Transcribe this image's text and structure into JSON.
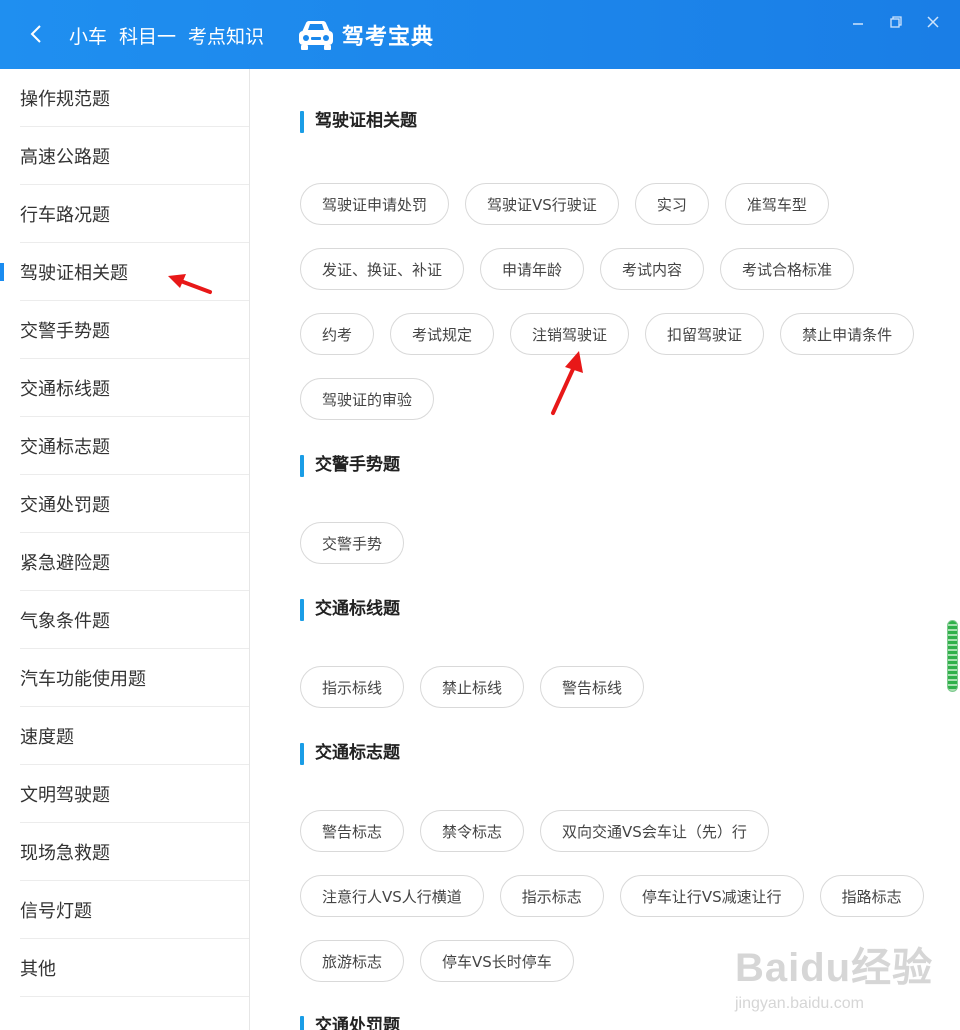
{
  "titlebar": {
    "breadcrumb": [
      "小车",
      "科目一",
      "考点知识"
    ],
    "brand": "驾考宝典"
  },
  "sidebar": {
    "items": [
      {
        "label": "操作规范题"
      },
      {
        "label": "高速公路题"
      },
      {
        "label": "行车路况题"
      },
      {
        "label": "驾驶证相关题",
        "active": true
      },
      {
        "label": "交警手势题"
      },
      {
        "label": "交通标线题"
      },
      {
        "label": "交通标志题"
      },
      {
        "label": "交通处罚题"
      },
      {
        "label": "紧急避险题"
      },
      {
        "label": "气象条件题"
      },
      {
        "label": "汽车功能使用题"
      },
      {
        "label": "速度题"
      },
      {
        "label": "文明驾驶题"
      },
      {
        "label": "现场急救题"
      },
      {
        "label": "信号灯题"
      },
      {
        "label": "其他"
      }
    ]
  },
  "sections": [
    {
      "title": "驾驶证相关题",
      "tags": [
        "驾驶证申请处罚",
        "驾驶证VS行驶证",
        "实习",
        "准驾车型",
        "发证、换证、补证",
        "申请年龄",
        "考试内容",
        "考试合格标准",
        "约考",
        "考试规定",
        "注销驾驶证",
        "扣留驾驶证",
        "禁止申请条件",
        "驾驶证的审验"
      ]
    },
    {
      "title": "交警手势题",
      "tags": [
        "交警手势"
      ]
    },
    {
      "title": "交通标线题",
      "tags": [
        "指示标线",
        "禁止标线",
        "警告标线"
      ]
    },
    {
      "title": "交通标志题",
      "tags": [
        "警告标志",
        "禁令标志",
        "双向交通VS会车让（先）行",
        "注意行人VS人行横道",
        "指示标志",
        "停车让行VS减速让行",
        "指路标志",
        "旅游标志",
        "停车VS长时停车"
      ]
    },
    {
      "title": "交通处罚题",
      "tags": []
    }
  ],
  "watermark": {
    "logo": "Baidu经验",
    "url": "jingyan.baidu.com"
  },
  "colors": {
    "titlebar": "#1a88ec",
    "accent": "#1a9de6",
    "annotation": "#e81818"
  }
}
